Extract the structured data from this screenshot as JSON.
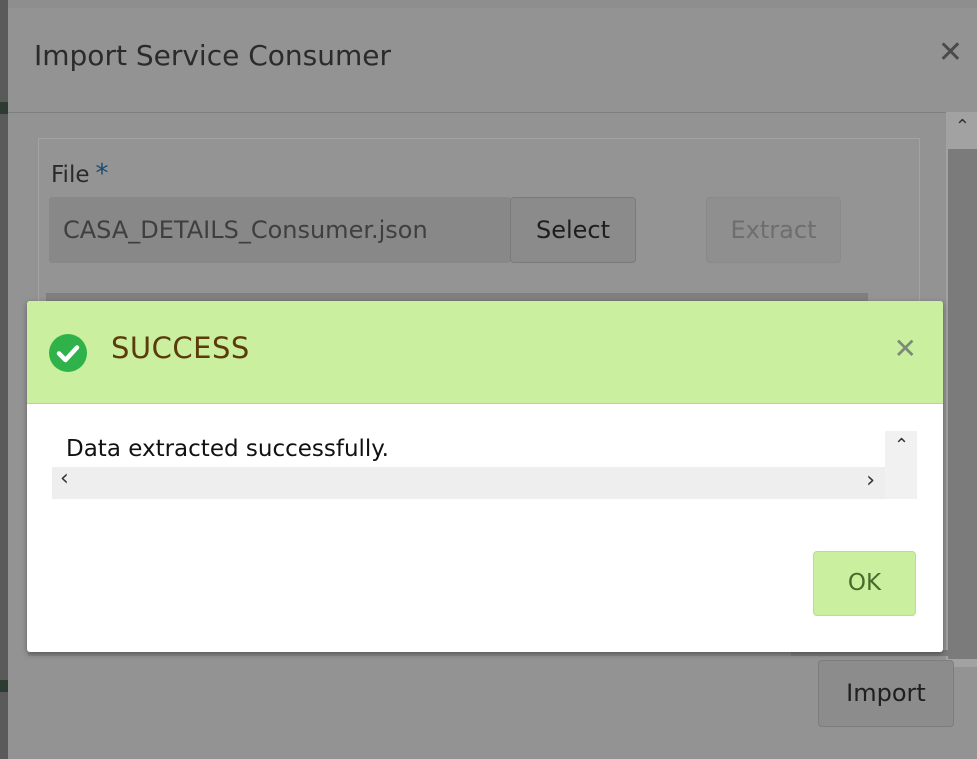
{
  "dialog": {
    "title": "Import Service Consumer",
    "close_icon": "close-icon",
    "file_label": "File",
    "required_marker": "*",
    "file_value": "CASA_DETAILS_Consumer.json",
    "select_label": "Select",
    "extract_label": "Extract",
    "import_label": "Import"
  },
  "modal": {
    "status_icon": "check-circle-icon",
    "title": "SUCCESS",
    "close_icon": "close-icon",
    "message": "Data extracted successfully.",
    "ok_label": "OK"
  },
  "colors": {
    "overlay": "#8e8e8e",
    "success_header": "#c9ef9f",
    "success_title": "#5c3a0b",
    "check_green": "#2fb24a"
  }
}
